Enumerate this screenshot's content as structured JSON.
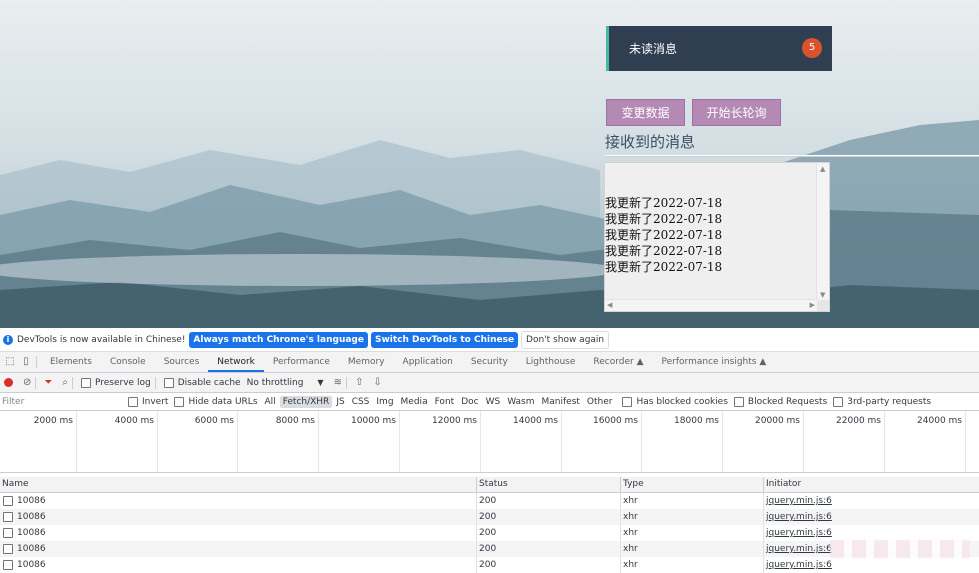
{
  "page": {
    "unread": {
      "label": "未读消息",
      "count": "5"
    },
    "buttons": {
      "change_data": "变更数据",
      "start_long_poll": "开始长轮询"
    },
    "received_title": "接收到的消息",
    "messages": [
      "我更新了2022-07-18",
      "我更新了2022-07-18",
      "我更新了2022-07-18",
      "我更新了2022-07-18",
      "我更新了2022-07-18"
    ]
  },
  "devtools": {
    "infobar": {
      "text": "DevTools is now available in Chinese!",
      "btn_match": "Always match Chrome's language",
      "btn_switch": "Switch DevTools to Chinese",
      "btn_dismiss": "Don't show again"
    },
    "tabs": [
      "Elements",
      "Console",
      "Sources",
      "Network",
      "Performance",
      "Memory",
      "Application",
      "Security",
      "Lighthouse",
      "Recorder ▲",
      "Performance insights ▲"
    ],
    "active_tab": "Network",
    "toolbar": {
      "preserve_log": "Preserve log",
      "disable_cache": "Disable cache",
      "throttling": "No throttling"
    },
    "filter": {
      "placeholder": "Filter",
      "invert": "Invert",
      "hide_data_urls": "Hide data URLs",
      "types": [
        "All",
        "Fetch/XHR",
        "JS",
        "CSS",
        "Img",
        "Media",
        "Font",
        "Doc",
        "WS",
        "Wasm",
        "Manifest",
        "Other"
      ],
      "selected_type": "Fetch/XHR",
      "blocked_cookies": "Has blocked cookies",
      "blocked_requests": "Blocked Requests",
      "third_party": "3rd-party requests"
    },
    "timeline_ticks": [
      "2000 ms",
      "4000 ms",
      "6000 ms",
      "8000 ms",
      "10000 ms",
      "12000 ms",
      "14000 ms",
      "16000 ms",
      "18000 ms",
      "20000 ms",
      "22000 ms",
      "24000 ms"
    ],
    "columns": {
      "name": "Name",
      "status": "Status",
      "type": "Type",
      "initiator": "Initiator"
    },
    "rows": [
      {
        "name": "10086",
        "status": "200",
        "type": "xhr",
        "initiator": "jquery.min.js:6"
      },
      {
        "name": "10086",
        "status": "200",
        "type": "xhr",
        "initiator": "jquery.min.js:6"
      },
      {
        "name": "10086",
        "status": "200",
        "type": "xhr",
        "initiator": "jquery.min.js:6"
      },
      {
        "name": "10086",
        "status": "200",
        "type": "xhr",
        "initiator": "jquery.min.js:6"
      },
      {
        "name": "10086",
        "status": "200",
        "type": "xhr",
        "initiator": "jquery.min.js:6"
      }
    ]
  }
}
